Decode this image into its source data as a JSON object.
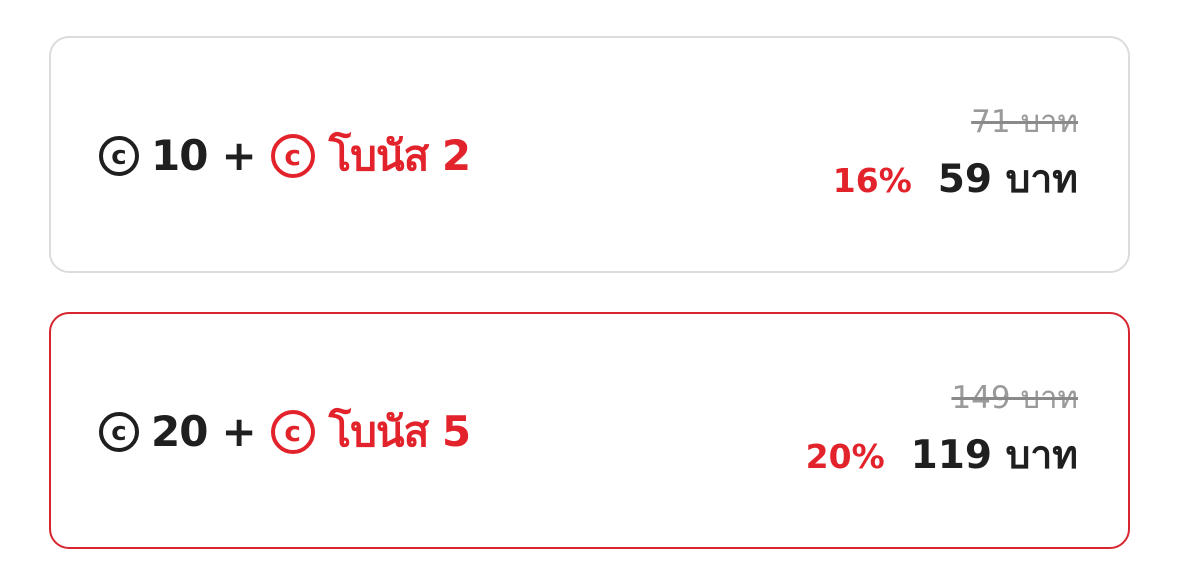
{
  "packages": [
    {
      "coin_symbol": "c",
      "coins": "10",
      "plus": "+",
      "bonus_symbol": "c",
      "bonus_label": "โบนัส 2",
      "original_price": "71 บาท",
      "discount": "16%",
      "price": "59 บาท",
      "selected": false
    },
    {
      "coin_symbol": "c",
      "coins": "20",
      "plus": "+",
      "bonus_symbol": "c",
      "bonus_label": "โบนัส 5",
      "original_price": "149 บาท",
      "discount": "20%",
      "price": "119 บาท",
      "selected": true
    }
  ],
  "colors": {
    "accent_red": "#e3232b",
    "text_dark": "#1f1f1f",
    "muted_gray": "#9a9a9a",
    "card_border": "#dcdcdc",
    "selected_border": "#d7262f"
  },
  "icons": {
    "coin": "coin-icon",
    "bonus_coin": "bonus-coin-icon"
  }
}
